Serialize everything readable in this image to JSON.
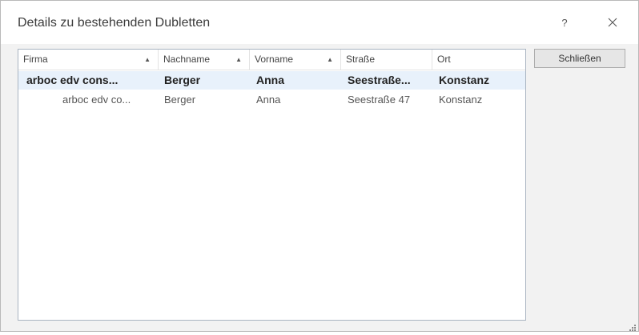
{
  "window": {
    "title": "Details zu bestehenden Dubletten",
    "help_glyph": "?"
  },
  "columns": [
    {
      "label": "Firma",
      "sort": "asc"
    },
    {
      "label": "Nachname",
      "sort": "asc"
    },
    {
      "label": "Vorname",
      "sort": "asc"
    },
    {
      "label": "Straße",
      "sort": ""
    },
    {
      "label": "Ort",
      "sort": ""
    }
  ],
  "sort_glyph": "▲",
  "rows": [
    {
      "firma": "arboc edv cons...",
      "nachname": "Berger",
      "vorname": "Anna",
      "strasse": "Seestraße...",
      "ort": "Konstanz"
    },
    {
      "firma": "arboc edv co...",
      "nachname": "Berger",
      "vorname": "Anna",
      "strasse": "Seestraße 47",
      "ort": "Konstanz"
    }
  ],
  "buttons": {
    "close_label": "Schließen"
  },
  "icons": {
    "help": "help-icon",
    "close": "close-icon",
    "sort": "sort-ascending-icon",
    "resize": "resize-grip-icon"
  },
  "colors": {
    "selection": "#e8f1fb",
    "list_border": "#a9b4c1"
  }
}
